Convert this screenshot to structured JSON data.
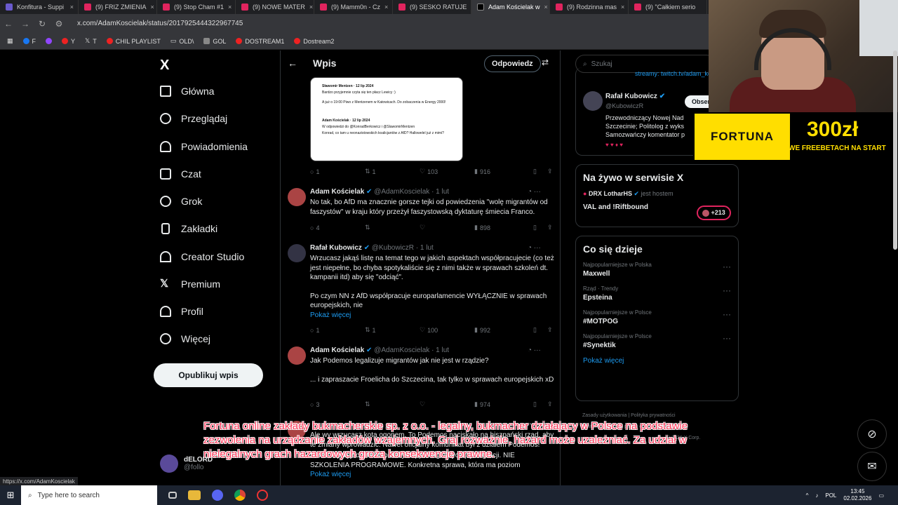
{
  "browser": {
    "tabs": [
      "Konfitura - Suppi",
      "(9) FRIZ ZMIENIA",
      "(9) Stop Cham #1",
      "(9) NOWE MATER",
      "(9) Mamm0n - Cz",
      "(9) SESKO RATUJE",
      "Adam Kościelak w",
      "(9) Rodzinna mas",
      "(9) \"Całkiem serio"
    ],
    "url": "x.com/AdamKoscielak/status/2017925444322967745",
    "bookmarks": [
      "F",
      "Y",
      "T",
      "CHIL PLAYLIST",
      "OLD\\",
      "GOL",
      "DOSTREAM1",
      "Dostream2"
    ]
  },
  "nav": {
    "logo": "X",
    "items": [
      "Główna",
      "Przeglądaj",
      "Powiadomienia",
      "Czat",
      "Grok",
      "Zakładki",
      "Creator Studio",
      "Premium",
      "Profil",
      "Więcej"
    ],
    "post_button": "Opublikuj wpis",
    "account_name": "dELORD",
    "account_handle": "@follo"
  },
  "center": {
    "title": "Wpis",
    "reply_button": "Odpowiedz",
    "quote": {
      "line1": "Sławomir Mentzen · 12 lip 2024",
      "line2": "Bardzo przyjemnie czyta się ten płacz Lewicy :)",
      "line3": "A już o 19:00 Piwo z Mentzenem w Katowicach. Do zobaczenia w Energy 2000!",
      "line4": "Adam Kościelak · 12 lip 2024",
      "line5": "W odpowiedzi do @KonradBerkowicz i @SlawomirMentzen",
      "line6": "Konrad, co tam u neonazistowskich koalicjantów z AfD? Hallowelel już z mimi?"
    },
    "first_actions": {
      "replies": "1",
      "reposts": "1",
      "likes": "103",
      "views": "916"
    },
    "posts": [
      {
        "name": "Adam Kościelak",
        "handle": "@AdamKoscielak",
        "time": "· 1 lut",
        "text": "No tak, bo AfD ma znacznie gorsze tejki od powiedzenia \"wolę migrantów od faszystów\" w kraju który przeżył faszystowską dyktaturę śmiecia Franco.",
        "replies": "4",
        "reposts": "",
        "likes": "",
        "views": "898"
      },
      {
        "name": "Rafał Kubowicz",
        "handle": "@KubowiczR",
        "time": "· 1 lut",
        "text": "Wrzucasz jakąś listę na temat tego w jakich aspektach współpracujecie (co też jest niepełne, bo chyba spotykaliście się z nimi także w sprawach szkoleń dt. kampanii itd) aby się \"odciąć\".",
        "text2": "Po czym NN z AfD współpracuje europarlamencie WYŁĄCZNIE w sprawach europejskich, nie",
        "more": "Pokaż więcej",
        "replies": "1",
        "reposts": "1",
        "likes": "100",
        "views": "992"
      },
      {
        "name": "Adam Kościelak",
        "handle": "@AdamKoscielak",
        "time": "· 1 lut",
        "text": "Jak Podemos legalizuje migrantów jak nie jest w rządzie?",
        "text2": "... i zapraszacie Froelicha do Szczecina, tak tylko w sprawach europejskich xD",
        "replies": "3",
        "reposts": "",
        "likes": "",
        "views": "974"
      },
      {
        "text": "Ale wy wrzucasz kota ogonem. To Podemos naciskało na hiszpański rząd, aby te zmiany wprowadzić. Nawet oficjalny komunikat był z działem Podemos!",
        "text2": "Froelich przyjechał i zrobiliśmy happening dotyczący migracji. NIE SZKOLENIA PROGRAMOWE. Konkretna sprawa, która ma poziom",
        "more": "Pokaż więcej"
      }
    ]
  },
  "right": {
    "search_placeholder": "Szukaj",
    "bio_link": "streamy: twitch.tv/adam_koscie",
    "profile_name": "Rafał Kubowicz",
    "profile_handle": "@KubowiczR",
    "follow": "Obserwuj",
    "bio": "Przewodniczący Nowej Nad Szczecinie; Politolog z wyks Samozwańczy komentator p",
    "live_title": "Na żywo w serwisie X",
    "live_host": "DRX LotharHS",
    "live_host_suffix": "jest hostem",
    "live_name": "VAL and !Riftbound",
    "live_count": "+213",
    "trends_title": "Co się dzieje",
    "trends": [
      {
        "context": "Najpopularniejsze w Polska",
        "topic": "Maxwell"
      },
      {
        "context": "Rząd · Trendy",
        "topic": "Epsteina"
      },
      {
        "context": "Najpopularniejsze w Polsce",
        "topic": "#MOTPOG"
      },
      {
        "context": "Najpopularniejsze w Polsce",
        "topic": "#Synektik"
      }
    ],
    "trends_more": "Pokaż więcej",
    "footer": [
      "Zasady użytkowania",
      "Polityka prywatności",
      "Polityka dotycząca plików cookie",
      "Dostępność",
      "© 2026 X Corp."
    ]
  },
  "ad": {
    "brand": "FORTUNA",
    "amount": "300zł",
    "tagline": "WE FREEBETACH NA START"
  },
  "disclaimer": "Fortuna online zakłady bukmacherskie sp. z o.o. - legalny, bukmacher działający w Polsce na podstawie zezwolenia na urządzanie zakładów wzajemnych. Graj rozważnie, hazard może uzależniać. Za udział w nielegalnych grach hazardowych grożą konsekwencje prawne.",
  "status_link": "https://x.com/AdamKoscielak",
  "taskbar": {
    "search": "Type here to search",
    "lang": "POL",
    "time": "13:45",
    "date": "02.02.2026"
  }
}
